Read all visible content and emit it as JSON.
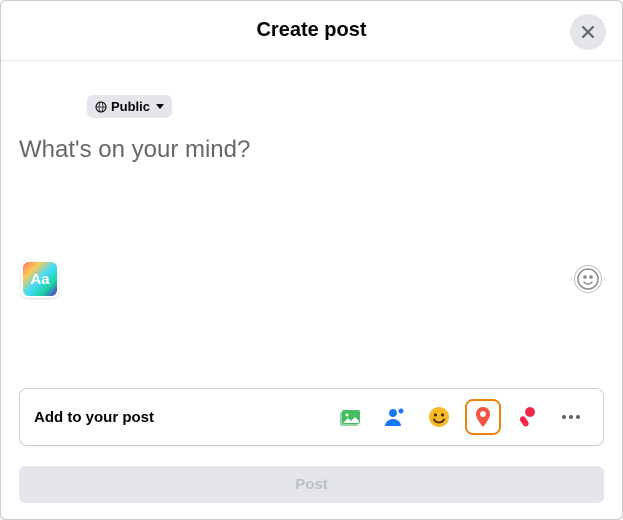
{
  "header": {
    "title": "Create post"
  },
  "audience": {
    "label": "Public"
  },
  "composer": {
    "placeholder": "What's on your mind?",
    "value": "",
    "bg_picker_label": "Aa"
  },
  "addto": {
    "label": "Add to your post"
  },
  "post_button": {
    "label": "Post"
  }
}
